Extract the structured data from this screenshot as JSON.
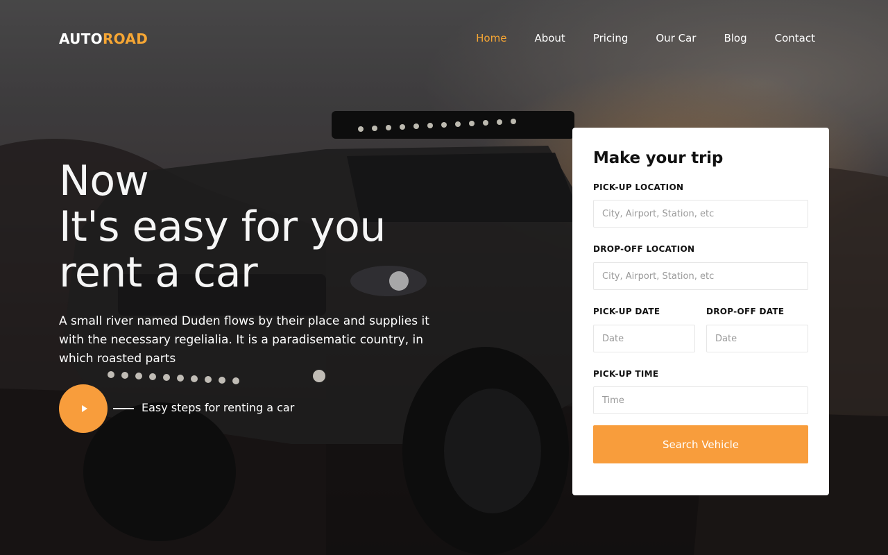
{
  "brand": {
    "part1": "AUTO",
    "part2": "ROAD"
  },
  "nav": {
    "items": [
      {
        "label": "Home",
        "active": true
      },
      {
        "label": "About"
      },
      {
        "label": "Pricing"
      },
      {
        "label": "Our Car"
      },
      {
        "label": "Blog"
      },
      {
        "label": "Contact"
      }
    ]
  },
  "hero": {
    "headline": [
      "Now",
      "It's easy for you",
      "rent a car"
    ],
    "subtitle": "A small river named Duden flows by their place and supplies it with the necessary regelialia. It is a paradisematic country, in which roasted parts",
    "play_icon": "play-icon",
    "steps_label": "Easy steps for renting a car"
  },
  "trip_form": {
    "title": "Make your trip",
    "pickup_location": {
      "label": "PICK-UP LOCATION",
      "placeholder": "City, Airport, Station, etc"
    },
    "dropoff_location": {
      "label": "DROP-OFF LOCATION",
      "placeholder": "City, Airport, Station, etc"
    },
    "pickup_date": {
      "label": "PICK-UP DATE",
      "placeholder": "Date"
    },
    "dropoff_date": {
      "label": "DROP-OFF DATE",
      "placeholder": "Date"
    },
    "pickup_time": {
      "label": "PICK-UP TIME",
      "placeholder": "Time"
    },
    "submit_label": "Search Vehicle"
  },
  "colors": {
    "accent": "#f89d3c",
    "brand_accent": "#f6a634"
  }
}
